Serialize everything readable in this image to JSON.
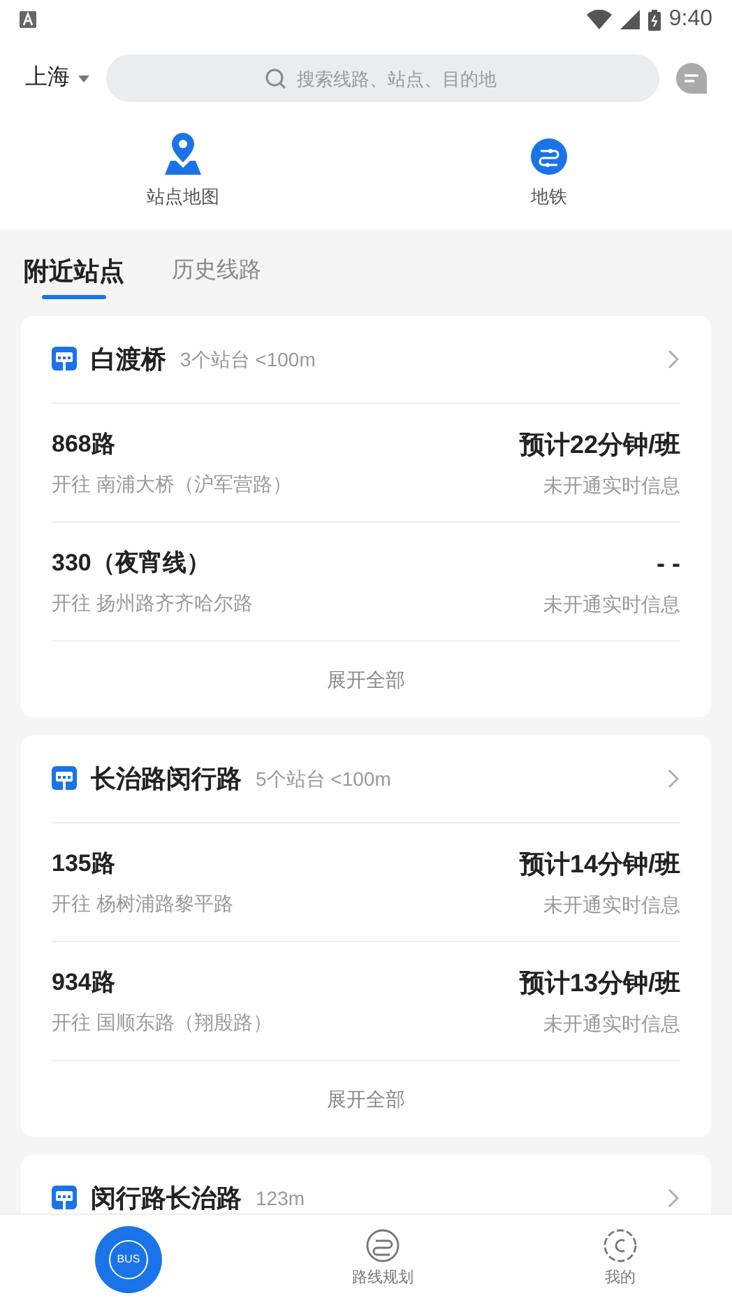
{
  "status_bar": {
    "time": "9:40"
  },
  "header": {
    "city": "上海",
    "search": {
      "placeholder": "搜索线路、站点、目的地"
    }
  },
  "shortcuts": [
    {
      "kind": "map",
      "label": "站点地图"
    },
    {
      "kind": "metro",
      "label": "地铁"
    }
  ],
  "tabs": [
    {
      "label": "附近站点",
      "selected": true
    },
    {
      "label": "历史线路",
      "selected": false
    }
  ],
  "stations": [
    {
      "name": "白渡桥",
      "info": "3个站台 <100m",
      "routes": [
        {
          "name": "868路",
          "direction": "开往 南浦大桥（沪军营路）",
          "eta": "预计22分钟/班",
          "realtime": "未开通实时信息"
        },
        {
          "name": "330（夜宵线）",
          "direction": "开往 扬州路齐齐哈尔路",
          "eta": "- -",
          "realtime": "未开通实时信息"
        }
      ],
      "expand": "展开全部"
    },
    {
      "name": "长治路闵行路",
      "info": "5个站台 <100m",
      "routes": [
        {
          "name": "135路",
          "direction": "开往 杨树浦路黎平路",
          "eta": "预计14分钟/班",
          "realtime": "未开通实时信息"
        },
        {
          "name": "934路",
          "direction": "开往 国顺东路（翔殷路）",
          "eta": "预计13分钟/班",
          "realtime": "未开通实时信息"
        }
      ],
      "expand": "展开全部"
    },
    {
      "name": "闵行路长治路",
      "info": "123m"
    }
  ],
  "bottom_nav": [
    {
      "kind": "bus",
      "label": "BUS",
      "selected": true
    },
    {
      "kind": "route",
      "label": "路线规划",
      "selected": false
    },
    {
      "kind": "me",
      "label": "我的",
      "selected": false
    }
  ]
}
